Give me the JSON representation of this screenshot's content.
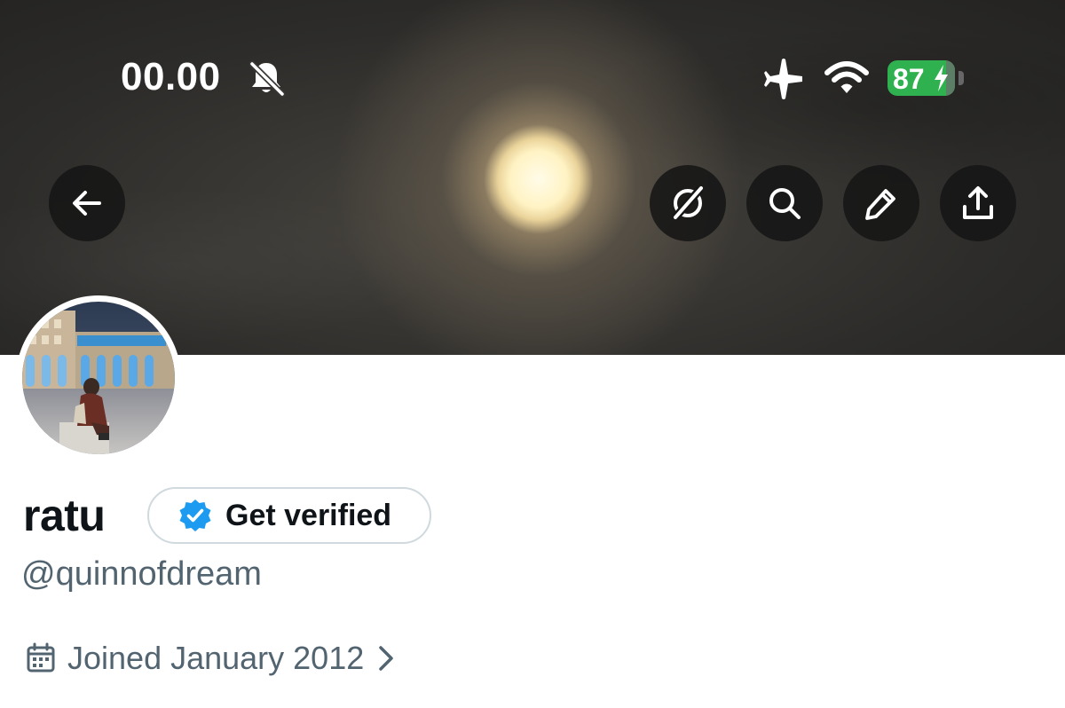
{
  "status_bar": {
    "time": "00.00",
    "battery_level": "87",
    "battery_fraction": 0.87
  },
  "header_actions": {
    "back_icon": "arrow-left-icon",
    "grok_icon": "grok-icon",
    "search_icon": "search-icon",
    "edit_icon": "pencil-icon",
    "share_icon": "share-icon"
  },
  "profile": {
    "display_name": "ratu",
    "verify_label": "Get verified",
    "handle": "@quinnofdream",
    "joined": "Joined January 2012"
  },
  "colors": {
    "verified_badge": "#1d9bf0",
    "text_primary": "#0f1419",
    "text_secondary": "#536471",
    "border": "#cfd9de",
    "battery": "#2fb14f"
  }
}
